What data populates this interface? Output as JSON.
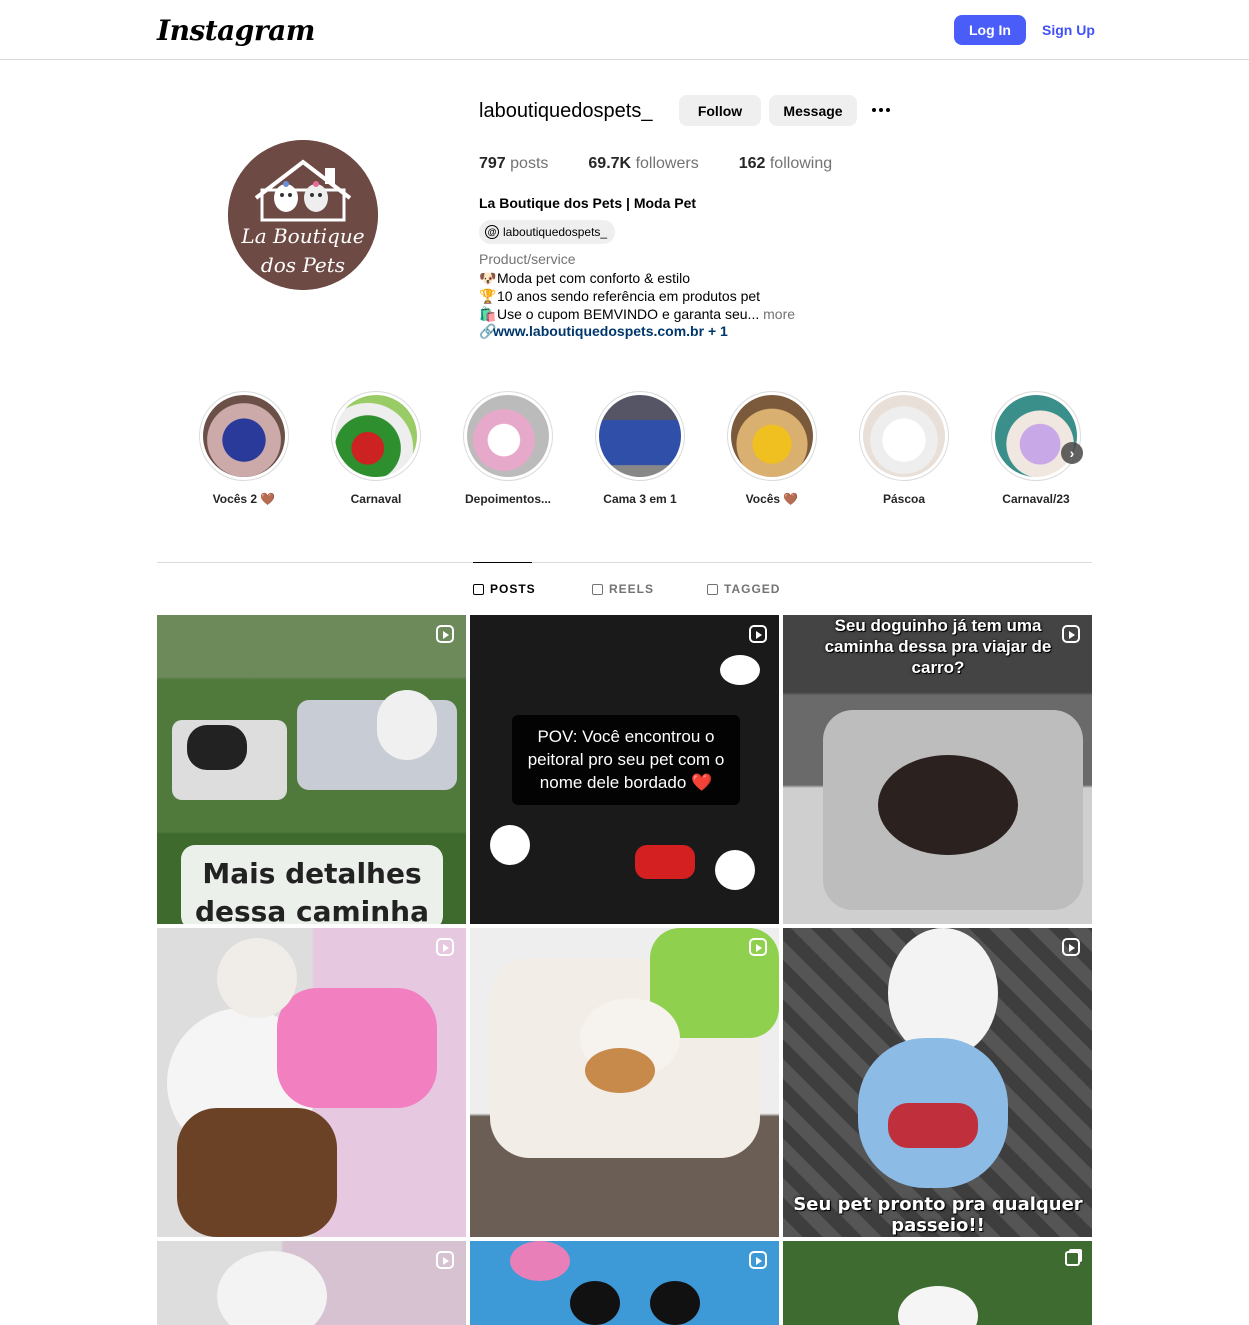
{
  "nav": {
    "logo": "Instagram",
    "login_label": "Log In",
    "signup_label": "Sign Up"
  },
  "profile": {
    "username": "laboutiquedospets_",
    "follow_label": "Follow",
    "message_label": "Message",
    "stats": {
      "posts_count": "797",
      "posts_label": "posts",
      "followers_count": "69.7K",
      "followers_label": "followers",
      "following_count": "162",
      "following_label": "following"
    },
    "full_name": "La Boutique dos Pets | Moda Pet",
    "threads_handle": "laboutiquedospets_",
    "category": "Product/service",
    "bio_lines": [
      {
        "emoji": "🐶",
        "text": "Moda pet com conforto & estilo"
      },
      {
        "emoji": "🏆",
        "text": "10 anos sendo referência em produtos pet"
      },
      {
        "emoji": "🛍️",
        "text": "Use o cupom BEMVINDO e garanta seu..."
      }
    ],
    "bio_more": "more",
    "website": "www.laboutiquedospets.com.br + 1",
    "avatar_text_1": "La Boutique",
    "avatar_text_2": "dos Pets"
  },
  "highlights": [
    {
      "label": "Vocês 2 🤎"
    },
    {
      "label": "Carnaval"
    },
    {
      "label": "Depoimentos..."
    },
    {
      "label": "Cama 3 em 1"
    },
    {
      "label": "Vocês 🤎"
    },
    {
      "label": "Páscoa"
    },
    {
      "label": "Carnaval/23"
    }
  ],
  "tabs": [
    {
      "label": "POSTS",
      "icon": "grid-icon",
      "active": true
    },
    {
      "label": "REELS",
      "icon": "reels-icon",
      "active": false
    },
    {
      "label": "TAGGED",
      "icon": "tagged-icon",
      "active": false
    }
  ],
  "posts": [
    {
      "type": "reel",
      "overlay": "Mais detalhes dessa caminha na legenda!"
    },
    {
      "type": "reel",
      "overlay": "POV: Você encontrou o peitoral pro seu pet com o nome dele bordado ❤️"
    },
    {
      "type": "reel",
      "overlay": "Seu doguinho já tem uma caminha dessa pra viajar de carro?"
    },
    {
      "type": "reel",
      "overlay": ""
    },
    {
      "type": "reel",
      "overlay": ""
    },
    {
      "type": "reel",
      "overlay": "Seu pet pronto pra qualquer passeio!!"
    },
    {
      "type": "reel",
      "overlay": ""
    },
    {
      "type": "reel",
      "overlay": ""
    },
    {
      "type": "carousel",
      "overlay": ""
    }
  ],
  "colors": {
    "accent": "#4a5df9",
    "link": "#00376b",
    "muted": "#737373",
    "border": "#dbdbdb",
    "avatar_bg": "#6e4a44"
  }
}
